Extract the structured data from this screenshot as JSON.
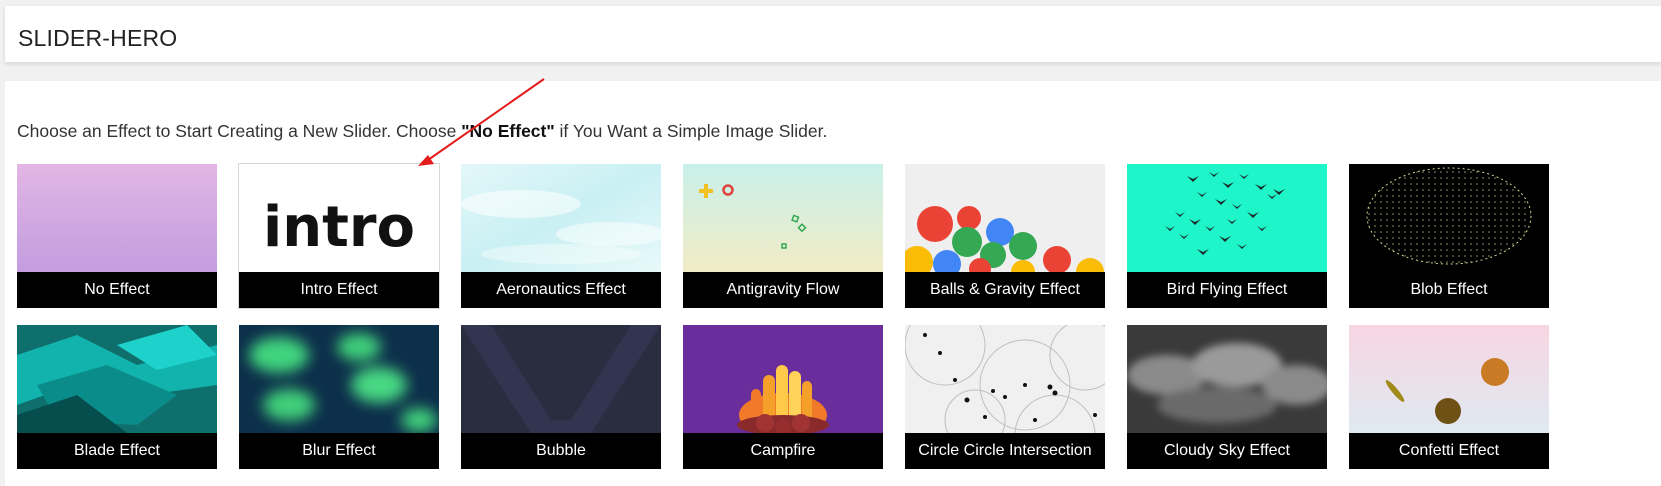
{
  "header": {
    "title": "SLIDER-HERO"
  },
  "intro": {
    "prefix": "Choose an Effect to Start Creating a New Slider. Choose ",
    "quote_open": "\"",
    "emphasis": "No Effect",
    "quote_close": "\"",
    "suffix": " if You Want a Simple Image Slider."
  },
  "effects": [
    {
      "label": "No Effect"
    },
    {
      "label": "Intro Effect",
      "logo_text": "intro"
    },
    {
      "label": "Aeronautics Effect"
    },
    {
      "label": "Antigravity Flow"
    },
    {
      "label": "Balls & Gravity Effect"
    },
    {
      "label": "Bird Flying Effect"
    },
    {
      "label": "Blob Effect"
    },
    {
      "label": "Blade Effect"
    },
    {
      "label": "Blur Effect"
    },
    {
      "label": "Bubble"
    },
    {
      "label": "Campfire"
    },
    {
      "label": "Circle Circle Intersection"
    },
    {
      "label": "Cloudy Sky Effect"
    },
    {
      "label": "Confetti Effect"
    }
  ],
  "annotation": {
    "color": "#e31b1b"
  }
}
